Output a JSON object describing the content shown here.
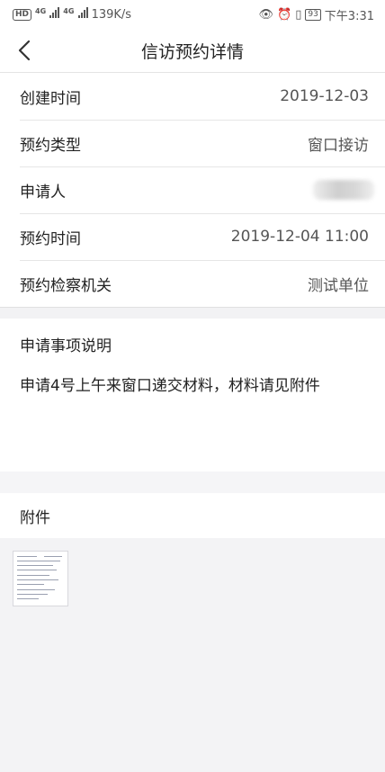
{
  "status_bar": {
    "hd": "HD",
    "net1": "4G",
    "net2": "4G",
    "speed": "139K/s",
    "battery": "93",
    "time": "下午3:31"
  },
  "header": {
    "title": "信访预约详情"
  },
  "details": {
    "created_label": "创建时间",
    "created_value": "2019-12-03",
    "type_label": "预约类型",
    "type_value": "窗口接访",
    "applicant_label": "申请人",
    "time_label": "预约时间",
    "time_value": "2019-12-04 11:00",
    "org_label": "预约检察机关",
    "org_value": "测试单位"
  },
  "description": {
    "title": "申请事项说明",
    "text": "申请4号上午来窗口递交材料，材料请见附件"
  },
  "attachments": {
    "title": "附件",
    "items": [
      "document-thumbnail"
    ]
  }
}
